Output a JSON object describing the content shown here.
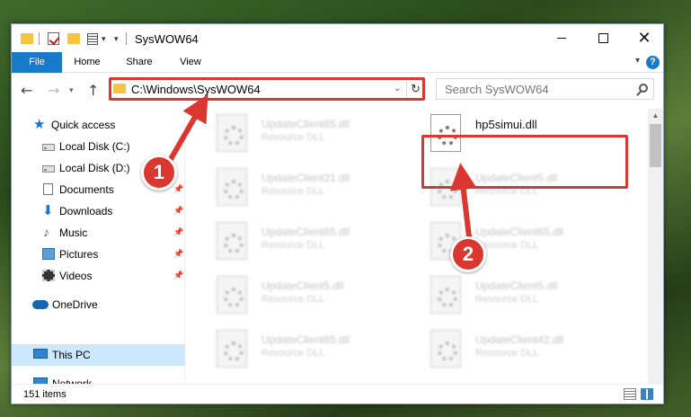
{
  "window": {
    "title": "SysWOW64",
    "minimize_icon": "minimize-icon",
    "maximize_icon": "maximize-icon",
    "close_glyph": "✕"
  },
  "ribbon": {
    "tabs": [
      "File",
      "Home",
      "Share",
      "View"
    ],
    "help_label": "?"
  },
  "address": {
    "path": "C:\\Windows\\SysWOW64",
    "search_placeholder": "Search SysWOW64"
  },
  "sidebar": {
    "items": [
      {
        "label": "Quick access",
        "icon": "star-icon"
      },
      {
        "label": "Local Disk (C:)",
        "icon": "drive-icon"
      },
      {
        "label": "Local Disk (D:)",
        "icon": "drive-icon"
      },
      {
        "label": "Documents",
        "icon": "documents-icon"
      },
      {
        "label": "Downloads",
        "icon": "downloads-icon"
      },
      {
        "label": "Music",
        "icon": "music-icon"
      },
      {
        "label": "Pictures",
        "icon": "pictures-icon"
      },
      {
        "label": "Videos",
        "icon": "videos-icon"
      },
      {
        "label": "OneDrive",
        "icon": "onedrive-icon"
      },
      {
        "label": "This PC",
        "icon": "this-pc-icon"
      },
      {
        "label": "Network",
        "icon": "network-icon"
      }
    ]
  },
  "files": [
    {
      "name": "UpdateClient65.dll",
      "type": "Resource DLL"
    },
    {
      "name": "hp5simui.dll",
      "type": ""
    },
    {
      "name": "UpdateClient21.dll",
      "type": "Resource DLL"
    },
    {
      "name": "UpdateClient5.dll",
      "type": "Resource DLL"
    },
    {
      "name": "UpdateClient65.dll",
      "type": "Resource DLL"
    },
    {
      "name": "UpdateClient65.dll",
      "type": "Resource DLL"
    },
    {
      "name": "UpdateClient5.dll",
      "type": "Resource DLL"
    },
    {
      "name": "UpdateClient5.dll",
      "type": "Resource DLL"
    },
    {
      "name": "UpdateClient65.dll",
      "type": "Resource DLL"
    },
    {
      "name": "UpdateClient42.dll",
      "type": "Resource DLL"
    }
  ],
  "status": {
    "item_count": "151 items"
  },
  "annotations": {
    "badge_1": "1",
    "badge_2": "2",
    "highlight_color": "#d9372f"
  }
}
